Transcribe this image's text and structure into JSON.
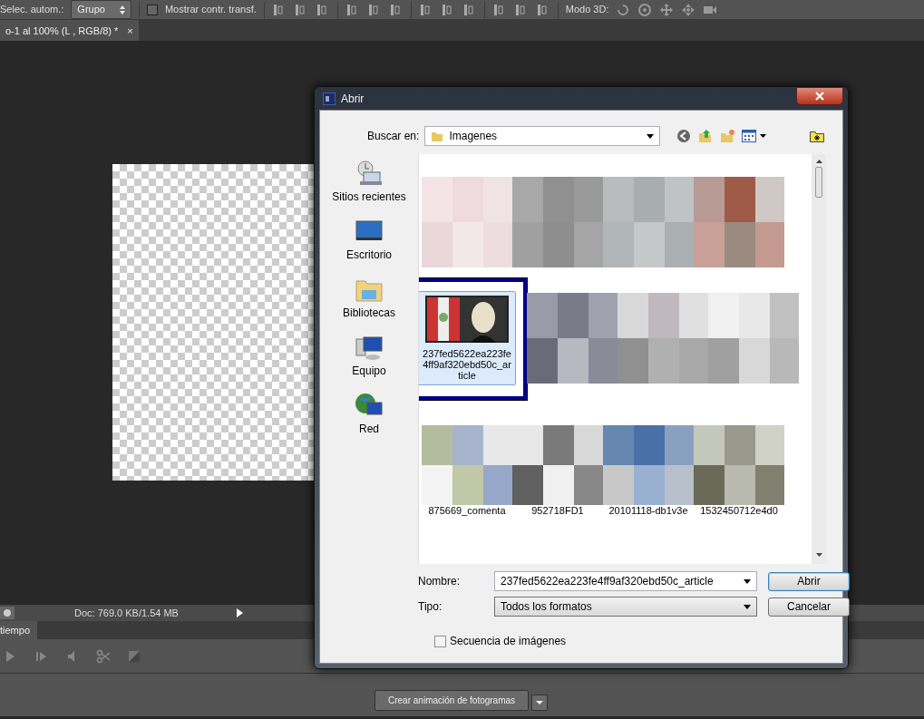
{
  "toolbar": {
    "auto_select_label": "Selec. autom.:",
    "auto_select_value": "Grupo",
    "show_transform": {
      "label": "Mostrar contr. transf.",
      "checked": false
    },
    "mode_3d_label": "Modo 3D:"
  },
  "document_tab": {
    "title": "o-1 al 100% (L , RGB/8) *",
    "close": "×"
  },
  "status_bar": {
    "doc_info": "Doc: 769.0 KB/1.54 MB"
  },
  "timeline": {
    "tab": "tiempo",
    "create_button": "Crear animación de fotogramas"
  },
  "dialog": {
    "title": "Abrir",
    "look_in_label": "Buscar en:",
    "look_in_value": "Imagenes",
    "places": [
      {
        "kind": "recent",
        "label": "Sitios recientes"
      },
      {
        "kind": "desktop",
        "label": "Escritorio"
      },
      {
        "kind": "libraries",
        "label": "Bibliotecas"
      },
      {
        "kind": "computer",
        "label": "Equipo"
      },
      {
        "kind": "network",
        "label": "Red"
      }
    ],
    "file_rows": [
      {
        "items": [
          {
            "selected": false
          },
          {
            "selected": false
          },
          {
            "selected": false
          },
          {
            "selected": false
          }
        ]
      },
      {
        "items": [
          {
            "selected": true,
            "name": "237fed5622ea223fe4ff9af320ebd50c_article"
          },
          {
            "selected": false
          },
          {
            "selected": false
          },
          {
            "selected": false
          }
        ]
      },
      {
        "items": [
          {
            "selected": false,
            "name": "875669_comenta"
          },
          {
            "selected": false,
            "name": "952718FD1"
          },
          {
            "selected": false,
            "name": "20101118-db1v3e"
          },
          {
            "selected": false,
            "name": "1532450712e4d0"
          }
        ]
      }
    ],
    "name_label": "Nombre:",
    "name_value": "237fed5622ea223fe4ff9af320ebd50c_article",
    "type_label": "Tipo:",
    "type_value": "Todos los formatos",
    "open_button": "Abrir",
    "cancel_button": "Cancelar",
    "sequence": {
      "label": "Secuencia de imágenes",
      "checked": false
    }
  }
}
